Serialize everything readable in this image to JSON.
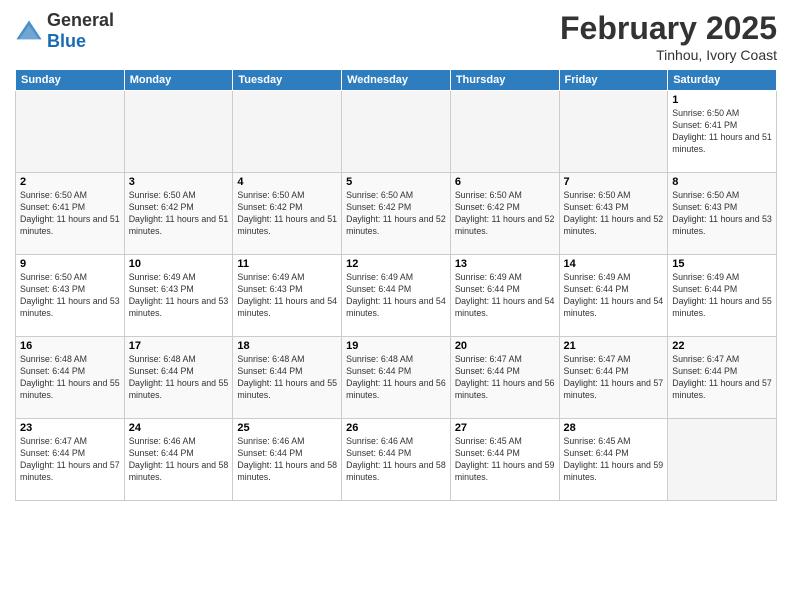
{
  "logo": {
    "general": "General",
    "blue": "Blue"
  },
  "title": "February 2025",
  "location": "Tinhou, Ivory Coast",
  "days_of_week": [
    "Sunday",
    "Monday",
    "Tuesday",
    "Wednesday",
    "Thursday",
    "Friday",
    "Saturday"
  ],
  "weeks": [
    [
      {
        "day": "",
        "empty": true
      },
      {
        "day": "",
        "empty": true
      },
      {
        "day": "",
        "empty": true
      },
      {
        "day": "",
        "empty": true
      },
      {
        "day": "",
        "empty": true
      },
      {
        "day": "",
        "empty": true
      },
      {
        "day": "1",
        "sunrise": "6:50 AM",
        "sunset": "6:41 PM",
        "daylight": "11 hours and 51 minutes."
      }
    ],
    [
      {
        "day": "2",
        "sunrise": "6:50 AM",
        "sunset": "6:41 PM",
        "daylight": "11 hours and 51 minutes."
      },
      {
        "day": "3",
        "sunrise": "6:50 AM",
        "sunset": "6:42 PM",
        "daylight": "11 hours and 51 minutes."
      },
      {
        "day": "4",
        "sunrise": "6:50 AM",
        "sunset": "6:42 PM",
        "daylight": "11 hours and 51 minutes."
      },
      {
        "day": "5",
        "sunrise": "6:50 AM",
        "sunset": "6:42 PM",
        "daylight": "11 hours and 52 minutes."
      },
      {
        "day": "6",
        "sunrise": "6:50 AM",
        "sunset": "6:42 PM",
        "daylight": "11 hours and 52 minutes."
      },
      {
        "day": "7",
        "sunrise": "6:50 AM",
        "sunset": "6:43 PM",
        "daylight": "11 hours and 52 minutes."
      },
      {
        "day": "8",
        "sunrise": "6:50 AM",
        "sunset": "6:43 PM",
        "daylight": "11 hours and 53 minutes."
      }
    ],
    [
      {
        "day": "9",
        "sunrise": "6:50 AM",
        "sunset": "6:43 PM",
        "daylight": "11 hours and 53 minutes."
      },
      {
        "day": "10",
        "sunrise": "6:49 AM",
        "sunset": "6:43 PM",
        "daylight": "11 hours and 53 minutes."
      },
      {
        "day": "11",
        "sunrise": "6:49 AM",
        "sunset": "6:43 PM",
        "daylight": "11 hours and 54 minutes."
      },
      {
        "day": "12",
        "sunrise": "6:49 AM",
        "sunset": "6:44 PM",
        "daylight": "11 hours and 54 minutes."
      },
      {
        "day": "13",
        "sunrise": "6:49 AM",
        "sunset": "6:44 PM",
        "daylight": "11 hours and 54 minutes."
      },
      {
        "day": "14",
        "sunrise": "6:49 AM",
        "sunset": "6:44 PM",
        "daylight": "11 hours and 54 minutes."
      },
      {
        "day": "15",
        "sunrise": "6:49 AM",
        "sunset": "6:44 PM",
        "daylight": "11 hours and 55 minutes."
      }
    ],
    [
      {
        "day": "16",
        "sunrise": "6:48 AM",
        "sunset": "6:44 PM",
        "daylight": "11 hours and 55 minutes."
      },
      {
        "day": "17",
        "sunrise": "6:48 AM",
        "sunset": "6:44 PM",
        "daylight": "11 hours and 55 minutes."
      },
      {
        "day": "18",
        "sunrise": "6:48 AM",
        "sunset": "6:44 PM",
        "daylight": "11 hours and 55 minutes."
      },
      {
        "day": "19",
        "sunrise": "6:48 AM",
        "sunset": "6:44 PM",
        "daylight": "11 hours and 56 minutes."
      },
      {
        "day": "20",
        "sunrise": "6:47 AM",
        "sunset": "6:44 PM",
        "daylight": "11 hours and 56 minutes."
      },
      {
        "day": "21",
        "sunrise": "6:47 AM",
        "sunset": "6:44 PM",
        "daylight": "11 hours and 57 minutes."
      },
      {
        "day": "22",
        "sunrise": "6:47 AM",
        "sunset": "6:44 PM",
        "daylight": "11 hours and 57 minutes."
      }
    ],
    [
      {
        "day": "23",
        "sunrise": "6:47 AM",
        "sunset": "6:44 PM",
        "daylight": "11 hours and 57 minutes."
      },
      {
        "day": "24",
        "sunrise": "6:46 AM",
        "sunset": "6:44 PM",
        "daylight": "11 hours and 58 minutes."
      },
      {
        "day": "25",
        "sunrise": "6:46 AM",
        "sunset": "6:44 PM",
        "daylight": "11 hours and 58 minutes."
      },
      {
        "day": "26",
        "sunrise": "6:46 AM",
        "sunset": "6:44 PM",
        "daylight": "11 hours and 58 minutes."
      },
      {
        "day": "27",
        "sunrise": "6:45 AM",
        "sunset": "6:44 PM",
        "daylight": "11 hours and 59 minutes."
      },
      {
        "day": "28",
        "sunrise": "6:45 AM",
        "sunset": "6:44 PM",
        "daylight": "11 hours and 59 minutes."
      },
      {
        "day": "",
        "empty": true
      }
    ]
  ]
}
